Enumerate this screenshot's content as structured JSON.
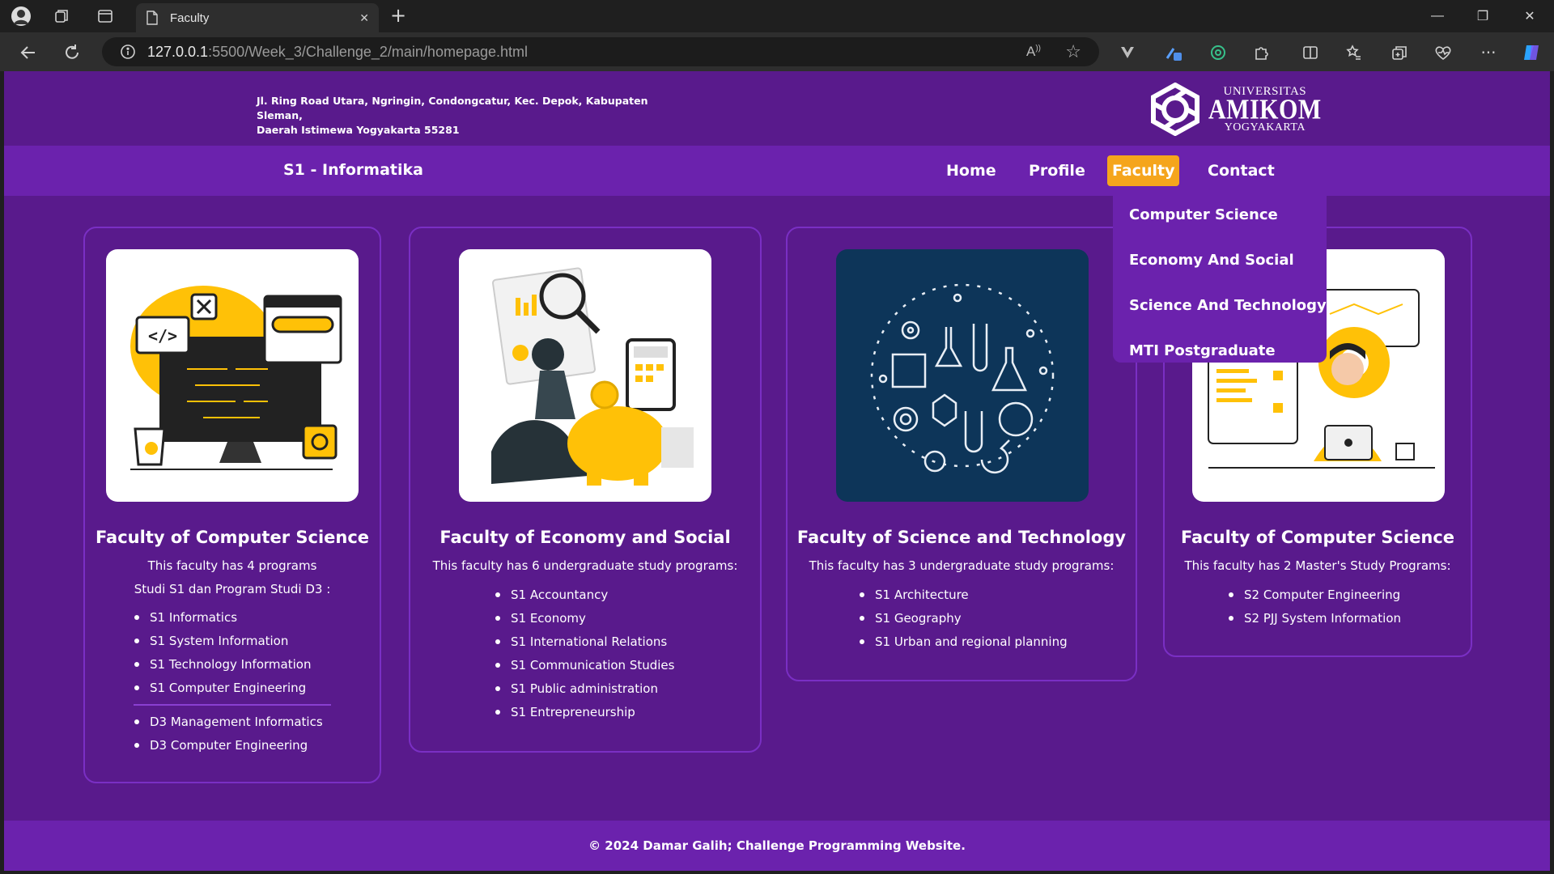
{
  "browser": {
    "tab_title": "Faculty",
    "url_host": "127.0.0.1",
    "url_path": ":5500/Week_3/Challenge_2/main/homepage.html"
  },
  "header": {
    "address_line1": "Jl. Ring Road Utara, Ngringin, Condongcatur, Kec. Depok, Kabupaten Sleman,",
    "address_line2": "Daerah Istimewa Yogyakarta 55281",
    "logo_line1": "UNIVERSITAS",
    "logo_line2": "AMIKOM",
    "logo_line3": "YOGYAKARTA"
  },
  "nav": {
    "brand": "S1 - Informatika",
    "items": [
      {
        "label": "Home"
      },
      {
        "label": "Profile"
      },
      {
        "label": "Faculty"
      },
      {
        "label": "Contact"
      }
    ],
    "active_color": "#f5a51c"
  },
  "dropdown": {
    "items": [
      {
        "label": "Computer Science"
      },
      {
        "label": "Economy And Social"
      },
      {
        "label": "Science And Technology"
      },
      {
        "label": "MTI Postgraduate"
      }
    ]
  },
  "cards": [
    {
      "title": "Faculty of Computer Science",
      "desc1": "This faculty has 4 programs",
      "desc2": "Studi S1 dan Program Studi D3 :",
      "list": [
        "S1 Informatics",
        "S1 System Information",
        "S1 Technology Information",
        "S1 Computer Engineering"
      ],
      "list2": [
        "D3 Management Informatics",
        "D3 Computer Engineering"
      ]
    },
    {
      "title": "Faculty of Economy and Social",
      "desc1": "This faculty has 6 undergraduate study programs:",
      "list": [
        "S1 Accountancy",
        "S1 Economy",
        "S1 International Relations",
        "S1 Communication Studies",
        "S1 Public administration",
        "S1 Entrepreneurship"
      ]
    },
    {
      "title": "Faculty of Science and Technology",
      "desc1": "This faculty has 3 undergraduate study programs:",
      "list": [
        "S1 Architecture",
        "S1 Geography",
        "S1 Urban and regional planning"
      ]
    },
    {
      "title": "Faculty of Computer Science",
      "desc1": "This faculty has 2 Master's Study Programs:",
      "list": [
        "S2 Computer Engineering",
        "S2 PJJ System Information"
      ]
    }
  ],
  "footer": {
    "text": "© 2024 Damar Galih; Challenge Programming Website."
  },
  "colors": {
    "page_bg": "#591a8c",
    "nav_bg": "#6b22ad",
    "card_border": "#7a2fc4",
    "accent": "#f5a51c",
    "science_image_bg": "#0d3559"
  }
}
